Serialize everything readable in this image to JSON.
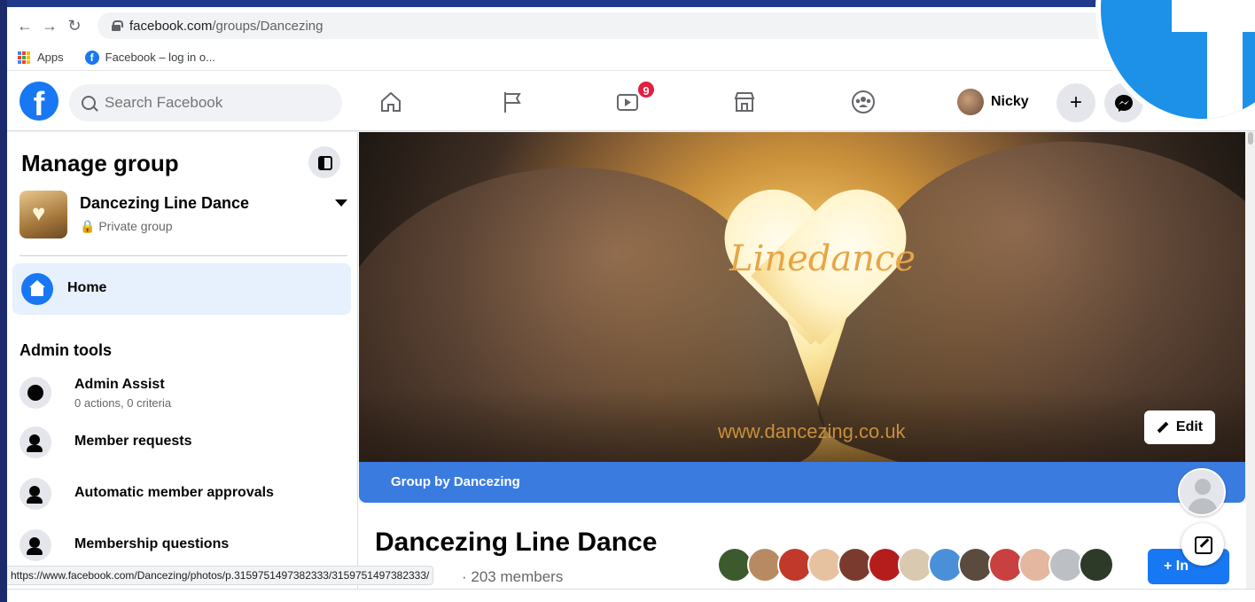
{
  "browser": {
    "url_host": "facebook.com",
    "url_path": "/groups/Dancezing",
    "bookmarks": [
      {
        "label": "Apps",
        "icon": "apps-icon"
      },
      {
        "label": "Facebook – log in o...",
        "icon": "facebook-icon"
      }
    ],
    "status_url": "https://www.facebook.com/Dancezing/photos/p.3159751497382333/3159751497382333/"
  },
  "header": {
    "search_placeholder": "Search Facebook",
    "watch_badge": "9",
    "profile_name": "Nicky",
    "create_label": "+",
    "brand_color": "#1877f2"
  },
  "sidebar": {
    "title": "Manage group",
    "group_name": "Dancezing Line Dance",
    "group_privacy": "Private group",
    "home_label": "Home",
    "section_title": "Admin tools",
    "items": [
      {
        "label": "Admin Assist",
        "sub": "0 actions, 0 criteria",
        "icon": "admin-assist-icon"
      },
      {
        "label": "Member requests",
        "sub": "",
        "icon": "member-requests-icon"
      },
      {
        "label": "Automatic member approvals",
        "sub": "",
        "icon": "member-approvals-icon"
      },
      {
        "label": "Membership questions",
        "sub": "",
        "icon": "membership-questions-icon"
      }
    ]
  },
  "cover": {
    "title": "Linedance",
    "url_text": "www.dancezing.co.uk",
    "edit_label": "Edit",
    "group_by": "Group by Dancezing"
  },
  "group": {
    "title": "Dancezing Line Dance",
    "members": "· 203 members",
    "invite_label": "+ In"
  }
}
